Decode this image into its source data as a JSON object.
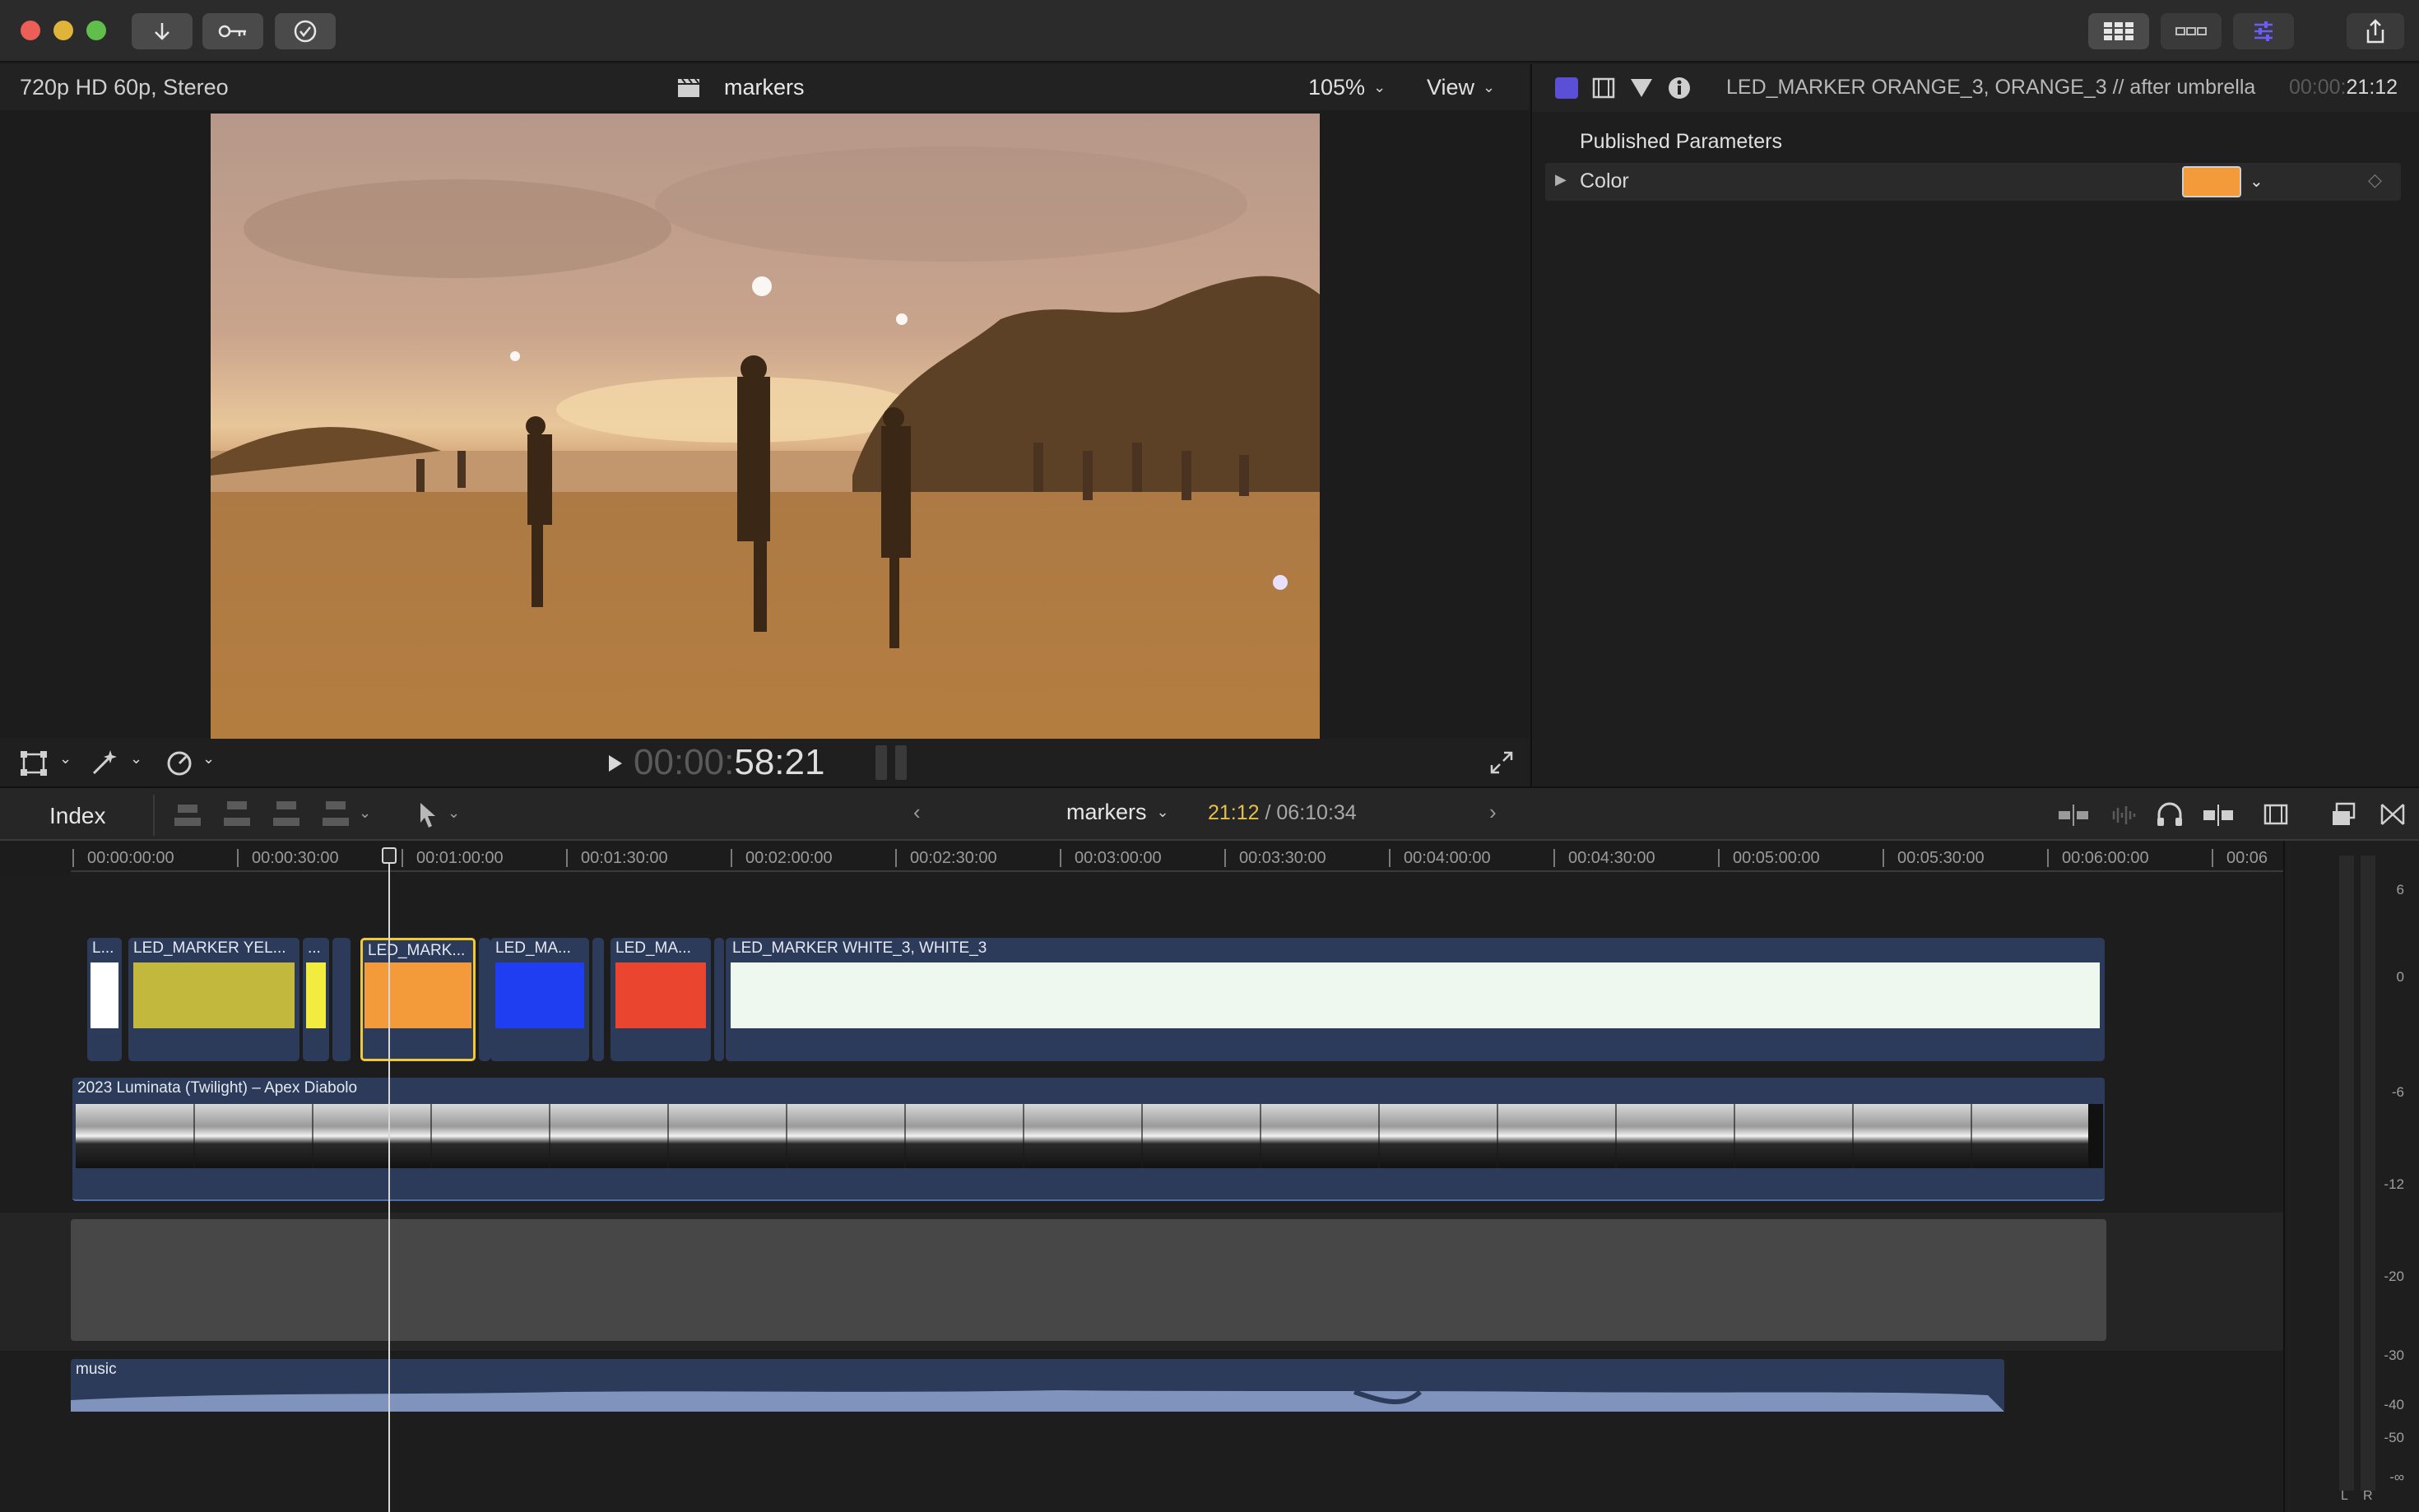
{
  "titlebar": {
    "import_icon": "download-arrow-icon",
    "keyword_icon": "key-icon",
    "check_icon": "checkmark-circle-icon",
    "layout_icons": [
      "grid-icon",
      "filmstrip-icon",
      "inspector-sliders-icon",
      "share-icon"
    ]
  },
  "viewer": {
    "format": "720p HD 60p, Stereo",
    "project_name": "markers",
    "zoom": "105%",
    "view_label": "View",
    "timecode_dim": "00:00:",
    "timecode_bright": "58:21"
  },
  "inspector": {
    "clip_title": "LED_MARKER ORANGE_3, ORANGE_3 // after umbrella",
    "duration_dim": "00:00:",
    "duration_bright": "21:12",
    "section_title": "Published Parameters",
    "param_label": "Color",
    "param_color": "#f39a3a"
  },
  "timeline": {
    "index_label": "Index",
    "project_name": "markers",
    "position": "21:12",
    "total": " / 06:10:34",
    "ruler": [
      "00:00:00:00",
      "00:00:30:00",
      "00:01:00:00",
      "00:01:30:00",
      "00:02:00:00",
      "00:02:30:00",
      "00:03:00:00",
      "00:03:30:00",
      "00:04:00:00",
      "00:04:30:00",
      "00:05:00:00",
      "00:05:30:00",
      "00:06:00:00",
      "00:06"
    ],
    "marker_clips": [
      {
        "label": "L...",
        "color": "#ffffff"
      },
      {
        "label": "LED_MARKER YEL...",
        "color": "#c2b83e"
      },
      {
        "label": "...",
        "color": "#f2ec3f"
      },
      {
        "label": "LED_MARK...",
        "color": "#f39a3a"
      },
      {
        "label": "LED_MA...",
        "color": "#1f3ef2"
      },
      {
        "label": "LED_MA...",
        "color": "#e9452f"
      },
      {
        "label": "LED_MARKER WHITE_3, WHITE_3",
        "color": "#eef8ee"
      }
    ],
    "video_clip_label": "2023 Luminata (Twilight) – Apex Diabolo",
    "audio_clip_label": "music"
  },
  "meters": {
    "scale": [
      "6",
      "0",
      "-6",
      "-12",
      "-20",
      "-30",
      "-40",
      "-50",
      "-∞"
    ],
    "channels": [
      "L",
      "R"
    ]
  }
}
